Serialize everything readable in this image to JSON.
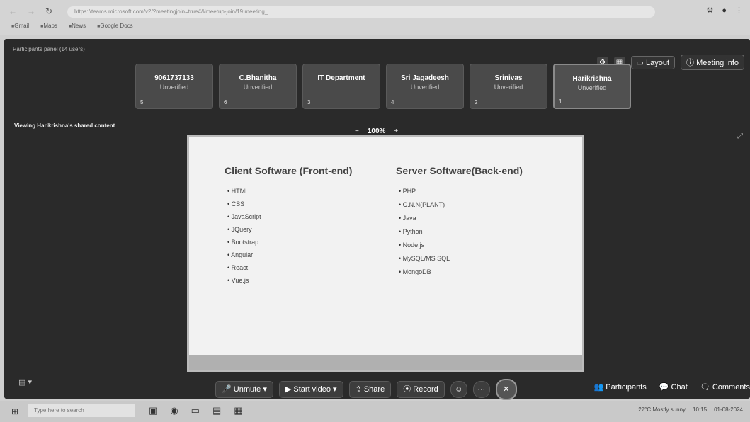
{
  "browser": {
    "url": "https://teams.microsoft.com/v2/?meetingjoin=true#/l/meetup-join/19:meeting_...",
    "bookmarks": [
      "Gmail",
      "Maps",
      "News",
      "Google Docs"
    ]
  },
  "meeting": {
    "title": "Participants panel (14 users)",
    "top_controls": {
      "layout": "Layout",
      "meeting_info": "Meeting info"
    },
    "participants": [
      {
        "name": "9061737133",
        "status": "Unverified",
        "num": "5"
      },
      {
        "name": "C.Bhanitha",
        "status": "Unverified",
        "num": "6"
      },
      {
        "name": "IT Department",
        "status": "",
        "num": "3"
      },
      {
        "name": "Sri Jagadeesh",
        "status": "Unverified",
        "num": "4"
      },
      {
        "name": "Srinivas",
        "status": "Unverified",
        "num": "2"
      },
      {
        "name": "Harikrishna",
        "status": "Unverified",
        "num": "1"
      }
    ],
    "viewing_label": "Viewing Harikrishna's shared content",
    "zoom": {
      "minus": "−",
      "value": "100%",
      "plus": "+"
    }
  },
  "slide": {
    "left_title": "Client Software (Front-end)",
    "left_items": [
      "HTML",
      "CSS",
      "JavaScript",
      "JQuery",
      "Bootstrap",
      "Angular",
      "React",
      "Vue.js"
    ],
    "right_title": "Server Software(Back-end)",
    "right_items": [
      "PHP",
      "C.N.N(PLANT)",
      "Java",
      "Python",
      "Node.js",
      "MySQL/MS SQL",
      "MongoDB"
    ]
  },
  "toolbar": {
    "unmute": "Unmute",
    "start_video": "Start video",
    "share": "Share",
    "record": "Record",
    "participants": "Participants",
    "chat": "Chat",
    "comments": "Comments"
  },
  "taskbar": {
    "search_placeholder": "Type here to search",
    "weather": "27°C Mostly sunny",
    "time": "10:15",
    "date": "01-08-2024"
  }
}
